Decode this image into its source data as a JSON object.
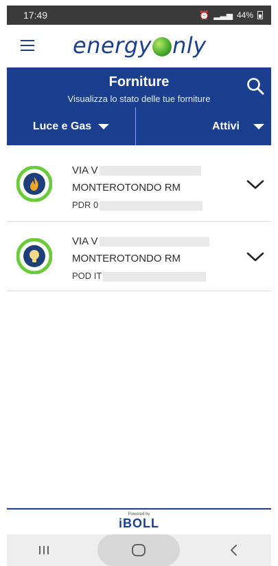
{
  "status": {
    "time": "17:49",
    "battery": "44%"
  },
  "header": {
    "logo_left": "energy",
    "logo_right": "nly"
  },
  "page": {
    "title": "Forniture",
    "subtitle": "Visualizza lo stato delle tue forniture"
  },
  "filters": {
    "type": "Luce e Gas",
    "state": "Attivi"
  },
  "supplies": [
    {
      "kind": "gas",
      "address": "VIA V",
      "city": "MONTEROTONDO RM",
      "code": "PDR 0"
    },
    {
      "kind": "luce",
      "address": "VIA V",
      "city": "MONTEROTONDO RM",
      "code": "POD IT"
    }
  ],
  "footer": {
    "powered_by": "Powered by",
    "brand": "iBOLL"
  },
  "colors": {
    "brand_blue": "#1b3f8f",
    "ring_green": "#6bcb3a",
    "badge_blue": "#1f3f7a",
    "badge_orange": "#f0a62a"
  }
}
